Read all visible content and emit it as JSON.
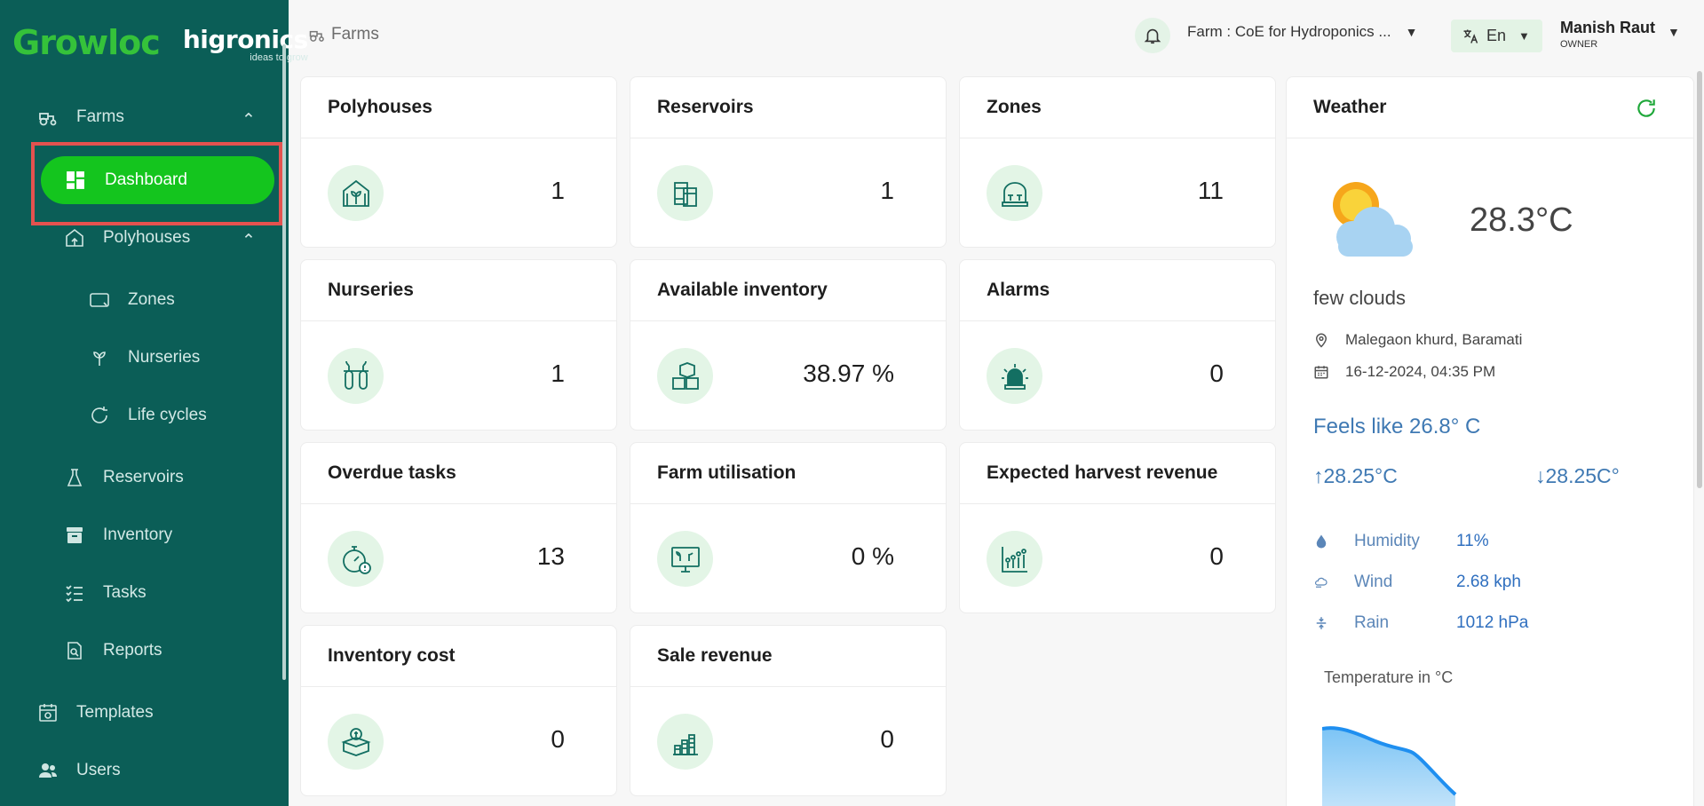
{
  "logo": {
    "growloc": "Growloc",
    "higronics": "higronics",
    "tagline": "ideas to grow"
  },
  "sidebar": {
    "farms": "Farms",
    "dashboard": "Dashboard",
    "polyhouses": "Polyhouses",
    "zones": "Zones",
    "nurseries": "Nurseries",
    "life_cycles": "Life cycles",
    "reservoirs": "Reservoirs",
    "inventory": "Inventory",
    "tasks": "Tasks",
    "reports": "Reports",
    "templates": "Templates",
    "users": "Users"
  },
  "topbar": {
    "breadcrumb": "Farms",
    "farm_select": "Farm : CoE for Hydroponics ...",
    "language": "En",
    "user_name": "Manish Raut",
    "user_role": "OWNER"
  },
  "cards": [
    {
      "title": "Polyhouses",
      "value": "1"
    },
    {
      "title": "Reservoirs",
      "value": "1"
    },
    {
      "title": "Zones",
      "value": "11"
    },
    {
      "title": "Nurseries",
      "value": "1"
    },
    {
      "title": "Available inventory",
      "value": "38.97 %"
    },
    {
      "title": "Alarms",
      "value": "0"
    },
    {
      "title": "Overdue tasks",
      "value": "13"
    },
    {
      "title": "Farm utilisation",
      "value": "0 %"
    },
    {
      "title": "Expected harvest revenue",
      "value": "0"
    },
    {
      "title": "Inventory cost",
      "value": "0"
    },
    {
      "title": "Sale revenue",
      "value": "0"
    }
  ],
  "weather": {
    "title": "Weather",
    "temperature": "28.3°C",
    "condition": "few clouds",
    "location": "Malegaon khurd, Baramati",
    "datetime": "16-12-2024, 04:35 PM",
    "feels_like": "Feels like 26.8° C",
    "high": "28.25°C",
    "low": "28.25C°",
    "humidity_label": "Humidity",
    "humidity": "11%",
    "wind_label": "Wind",
    "wind": "2.68 kph",
    "rain_label": "Rain",
    "rain": "1012 hPa",
    "chart_title": "Temperature in °C"
  },
  "colors": {
    "sidebar_bg": "#0b5e57",
    "accent_green": "#14c51e",
    "highlight_red": "#e4524f",
    "icon_circle": "#e3f5e6",
    "weather_blue": "#3f79b3"
  }
}
